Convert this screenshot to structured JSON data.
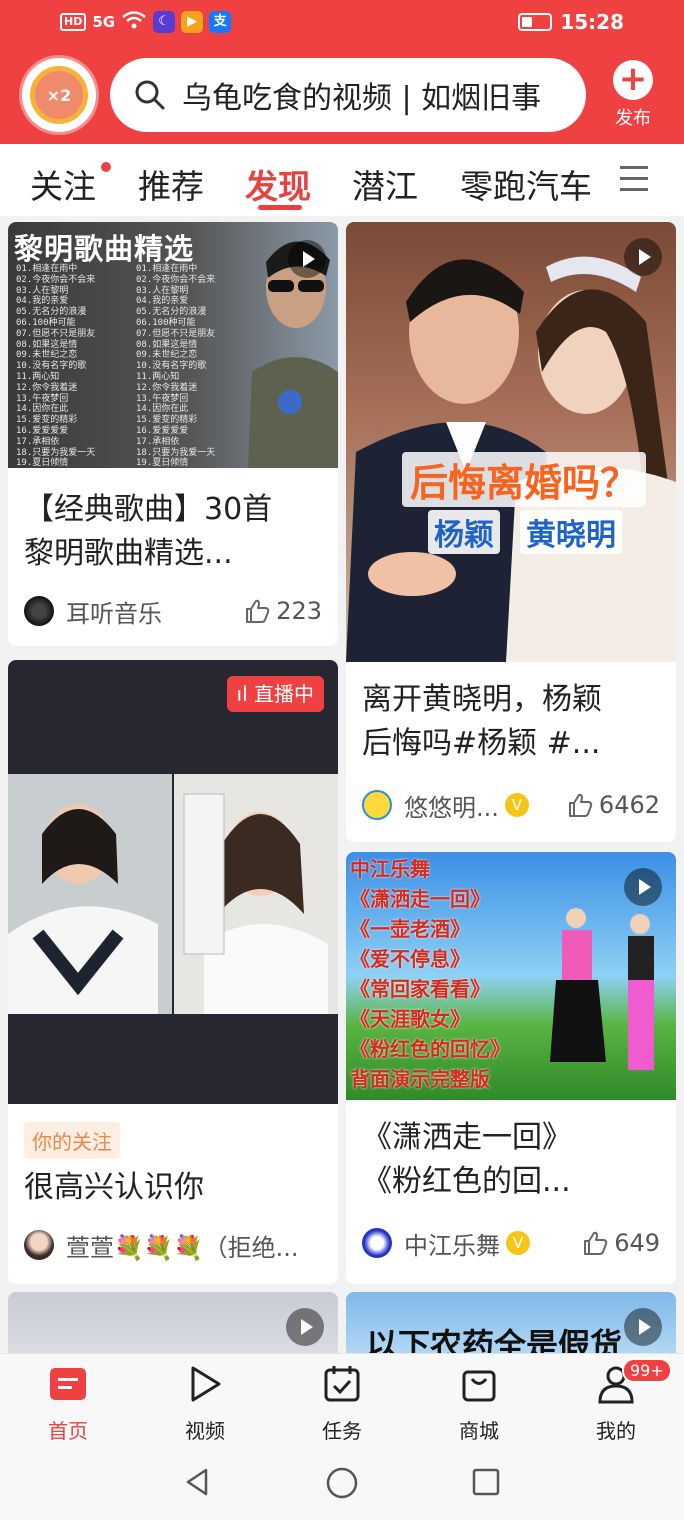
{
  "status_bar": {
    "network": "HD",
    "signal": "5G",
    "time": "15:28"
  },
  "header": {
    "coin_badge": "×2",
    "search_text": "乌龟吃食的视频 | 如烟旧事",
    "publish_label": "发布"
  },
  "tabs": [
    {
      "label": "关注"
    },
    {
      "label": "推荐"
    },
    {
      "label": "发现"
    },
    {
      "label": "潜江"
    },
    {
      "label": "零跑汽车"
    }
  ],
  "active_tab": "发现",
  "feed": {
    "card1": {
      "thumb_title": "黎明歌曲精选",
      "title": "【经典歌曲】30首黎明歌曲精选...",
      "title_line1": "【经典歌曲】30首",
      "title_line2": "黎明歌曲精选...",
      "author": "耳听音乐",
      "likes": "223"
    },
    "card2": {
      "thumb_headline": "后悔离婚吗？",
      "thumb_name1": "杨颖",
      "thumb_name2": "黄晓明",
      "title_line1": "离开黄晓明，杨颖",
      "title_line2": "后悔吗#杨颖 #...",
      "author": "悠悠明...",
      "likes": "6462"
    },
    "card3": {
      "live_label": "直播中",
      "follow_tag": "你的关注",
      "title": "很高兴认识你",
      "author": "萱萱💐💐💐（拒绝..."
    },
    "card4": {
      "thumb_lines": [
        "中江乐舞",
        "《潇洒走一回》",
        "《一壶老酒》",
        "《爱不停息》",
        "《常回家看看》",
        "《天涯歌女》",
        "《粉红色的回忆》",
        "背面演示完整版"
      ],
      "title_line1": "《潇洒走一回》",
      "title_line2": "《粉红色的回...",
      "author": "中江乐舞",
      "likes": "649"
    },
    "card6": {
      "thumb_text": "以下农药全是假货"
    }
  },
  "bottom_nav": [
    {
      "label": "首页"
    },
    {
      "label": "视频"
    },
    {
      "label": "任务"
    },
    {
      "label": "商城"
    },
    {
      "label": "我的"
    }
  ],
  "profile_badge": "99+",
  "colors": {
    "brand_red": "#f04142",
    "verified_gold": "#f5c518"
  }
}
